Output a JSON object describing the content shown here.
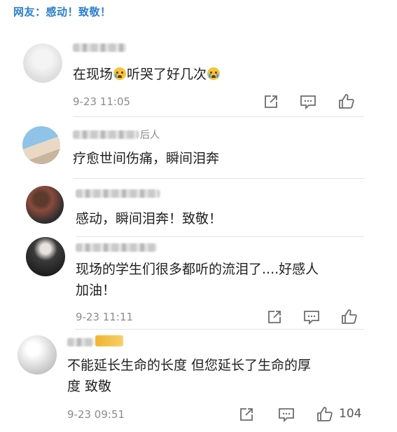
{
  "header": {
    "title": "网友：感动！致敬！"
  },
  "comments": [
    {
      "name_tail": "",
      "text_before": "在现场",
      "emoji1": "crying-emoji",
      "text_mid": "听哭了好几次",
      "emoji2": "sobbing-emoji",
      "time": "9-23 11:05",
      "likes": ""
    },
    {
      "name_tail": "后人",
      "text": "疗愈世间伤痛，瞬间泪奔"
    },
    {
      "name_tail": "",
      "text": "感动，瞬间泪奔！致敬！"
    },
    {
      "name_tail": "",
      "line1": "现场的学生们很多都听的流泪了....好感人",
      "line2": "加油！",
      "time": "9-23 11:11",
      "likes": ""
    },
    {
      "name_tail": "",
      "line1": "不能延长生命的长度 但您延长了生命的厚",
      "line2": "度 致敬",
      "time": "9-23 09:51",
      "likes": "104"
    }
  ],
  "icons": {
    "share": "share-icon",
    "reply": "reply-icon",
    "like": "thumbs-up-icon"
  },
  "colors": {
    "header": "#2a7fd0",
    "text": "#1f1f1f",
    "meta": "#8c8c8c"
  }
}
